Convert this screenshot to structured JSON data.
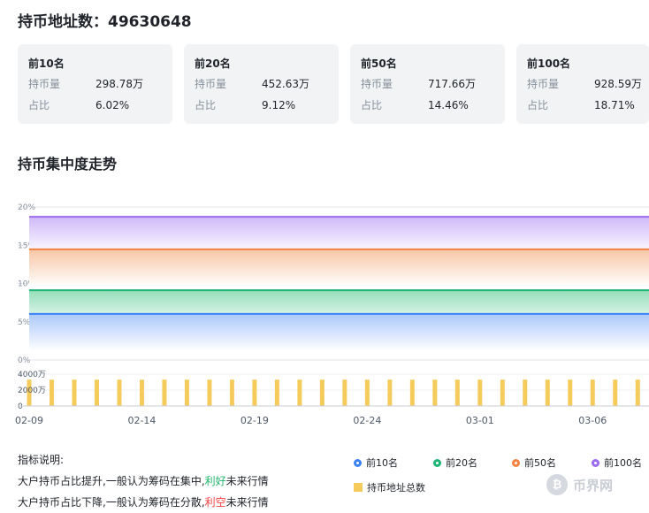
{
  "header": {
    "title": "持币地址数：49630648"
  },
  "cards": [
    {
      "title": "前10名",
      "holding_label": "持币量",
      "holding_value": "298.78万",
      "ratio_label": "占比",
      "ratio_value": "6.02%"
    },
    {
      "title": "前20名",
      "holding_label": "持币量",
      "holding_value": "452.63万",
      "ratio_label": "占比",
      "ratio_value": "9.12%"
    },
    {
      "title": "前50名",
      "holding_label": "持币量",
      "holding_value": "717.66万",
      "ratio_label": "占比",
      "ratio_value": "14.46%"
    },
    {
      "title": "前100名",
      "holding_label": "持币量",
      "holding_value": "928.59万",
      "ratio_label": "占比",
      "ratio_value": "18.71%"
    }
  ],
  "section": {
    "title": "持币集中度走势"
  },
  "chart_data": {
    "type": "line",
    "x": [
      "02-09",
      "02-10",
      "02-11",
      "02-12",
      "02-13",
      "02-14",
      "02-15",
      "02-16",
      "02-17",
      "02-18",
      "02-19",
      "02-20",
      "02-21",
      "02-22",
      "02-23",
      "02-24",
      "02-25",
      "02-26",
      "02-27",
      "02-28",
      "03-01",
      "03-02",
      "03-03",
      "03-04",
      "03-05",
      "03-06",
      "03-07",
      "03-08"
    ],
    "x_tick_labels": [
      "02-09",
      "02-14",
      "02-19",
      "02-24",
      "03-01",
      "03-06"
    ],
    "upper_y_ticks": [
      "20%",
      "15%",
      "10%",
      "5%",
      "0%"
    ],
    "upper_ylim": [
      0,
      20
    ],
    "lower_y_ticks": [
      "4000万",
      "2000万",
      "0"
    ],
    "lower_ylim": [
      0,
      6000
    ],
    "grid": true,
    "legend_position": "bottom-right",
    "series": [
      {
        "name": "前10名",
        "color": "#3b82f6",
        "fill_from": "#a9c6fb",
        "values": [
          6.02,
          6.02,
          6.02,
          6.02,
          6.02,
          6.02,
          6.02,
          6.02,
          6.02,
          6.02,
          6.02,
          6.02,
          6.02,
          6.02,
          6.02,
          6.02,
          6.02,
          6.02,
          6.02,
          6.02,
          6.02,
          6.02,
          6.02,
          6.02,
          6.02,
          6.02,
          6.02,
          6.02
        ]
      },
      {
        "name": "前20名",
        "color": "#1fb574",
        "fill_from": "#8fdcb5",
        "values": [
          9.12,
          9.12,
          9.12,
          9.12,
          9.12,
          9.12,
          9.12,
          9.12,
          9.12,
          9.12,
          9.12,
          9.12,
          9.12,
          9.12,
          9.12,
          9.12,
          9.12,
          9.12,
          9.12,
          9.12,
          9.12,
          9.12,
          9.12,
          9.12,
          9.12,
          9.12,
          9.12,
          9.12
        ]
      },
      {
        "name": "前50名",
        "color": "#f28342",
        "fill_from": "#f6c3a1",
        "values": [
          14.46,
          14.46,
          14.46,
          14.46,
          14.46,
          14.46,
          14.46,
          14.46,
          14.46,
          14.46,
          14.46,
          14.46,
          14.46,
          14.46,
          14.46,
          14.46,
          14.46,
          14.46,
          14.46,
          14.46,
          14.46,
          14.46,
          14.46,
          14.46,
          14.46,
          14.46,
          14.46,
          14.46
        ]
      },
      {
        "name": "前100名",
        "color": "#9b6cf0",
        "fill_from": "#cdb6f8",
        "values": [
          18.71,
          18.71,
          18.71,
          18.71,
          18.71,
          18.71,
          18.71,
          18.71,
          18.71,
          18.71,
          18.71,
          18.71,
          18.71,
          18.71,
          18.71,
          18.71,
          18.71,
          18.71,
          18.71,
          18.71,
          18.71,
          18.71,
          18.71,
          18.71,
          18.71,
          18.71,
          18.71,
          18.71
        ]
      }
    ],
    "bar_series": {
      "name": "持币地址总数",
      "color": "#f5cb5c",
      "values": [
        4963,
        4963,
        4963,
        4963,
        4963,
        4963,
        4963,
        4963,
        4963,
        4963,
        4963,
        4963,
        4963,
        4963,
        4963,
        4963,
        4963,
        4963,
        4963,
        4963,
        4963,
        4963,
        4963,
        4963,
        4963,
        4963,
        4963,
        4963
      ]
    }
  },
  "notes": {
    "title": "指标说明:",
    "line1_prefix": "大户持币占比提升,一般认为筹码在集中,",
    "line1_highlight": "利好",
    "line1_suffix": "未来行情",
    "line2_prefix": "大户持币占比下降,一般认为筹码在分散,",
    "line2_highlight": "利空",
    "line2_suffix": "未来行情"
  },
  "legend": {
    "items": [
      {
        "label": "前10名",
        "color": "#3b82f6"
      },
      {
        "label": "前20名",
        "color": "#1fb574"
      },
      {
        "label": "前50名",
        "color": "#f28342"
      },
      {
        "label": "前100名",
        "color": "#9b6cf0"
      }
    ],
    "bar_label": "持币地址总数",
    "bar_color": "#f5cb5c"
  },
  "watermark": {
    "text": "币界网",
    "icon": "bitcoin-icon"
  }
}
